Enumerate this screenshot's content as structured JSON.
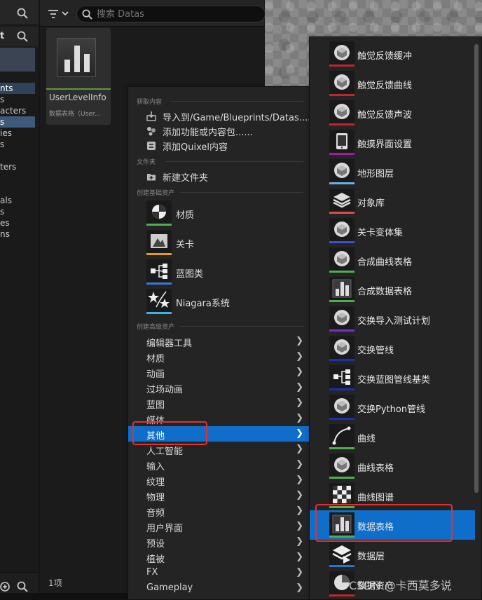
{
  "left_panel": {
    "tree_items": [
      "nts",
      "s",
      "acters",
      "s",
      "ies",
      "s",
      "ters",
      "als",
      "s",
      "es",
      "ns"
    ],
    "header_fragment": "t"
  },
  "asset_area": {
    "search_placeholder": "搜索 Datas",
    "asset": {
      "name": "UserLevelInfo",
      "type": "数据表格（User..."
    },
    "item_count": "1项"
  },
  "context_menu": {
    "sections": {
      "get_content": "获取内容",
      "folder": "文件夹",
      "basic_assets": "创建基础资产",
      "advanced_assets": "创建高级资产"
    },
    "get_content_items": [
      "导入到/Game/Blueprints/Datas.....",
      "添加功能或内容包......",
      "添加Quixel内容"
    ],
    "folder_items": [
      "新建文件夹"
    ],
    "basic_items": [
      {
        "label": "材质",
        "icon": "material-icon",
        "color": "#4caf50"
      },
      {
        "label": "关卡",
        "icon": "level-icon",
        "color": "#e89a1c"
      },
      {
        "label": "蓝图类",
        "icon": "blueprint-icon",
        "color": "#3a7bd5"
      },
      {
        "label": "Niagara系统",
        "icon": "niagara-icon",
        "color": "#2fb8e8"
      }
    ],
    "advanced_items": [
      "编辑器工具",
      "材质",
      "动画",
      "过场动画",
      "蓝图",
      "媒体",
      "其他",
      "人工智能",
      "输入",
      "纹理",
      "物理",
      "音频",
      "用户界面",
      "预设",
      "植被",
      "FX",
      "Gameplay"
    ],
    "selected": "其他"
  },
  "sub_menu": {
    "items": [
      {
        "label": "触觉反馈缓冲",
        "icon": "cube-icon",
        "color": "#c0262b"
      },
      {
        "label": "触觉反馈曲线",
        "icon": "cube-icon",
        "color": "#c0262b"
      },
      {
        "label": "触觉反馈声波",
        "icon": "cube-icon",
        "color": "#c0262b"
      },
      {
        "label": "触摸界面设置",
        "icon": "tablet-icon",
        "color": "#a31aa3"
      },
      {
        "label": "地形图层",
        "icon": "cube-icon",
        "color": "#6ab0e6"
      },
      {
        "label": "对象库",
        "icon": "stack-icon",
        "color": "#e14a4a"
      },
      {
        "label": "关卡变体集",
        "icon": "cube-icon",
        "color": "#3c4fd0"
      },
      {
        "label": "合成曲线表格",
        "icon": "cube-icon",
        "color": "#4caf50"
      },
      {
        "label": "合成数据表格",
        "icon": "datatable-icon",
        "color": "#4caf50"
      },
      {
        "label": "交换导入测试计划",
        "icon": "cube-icon",
        "color": "#7b2bd0"
      },
      {
        "label": "交换管线",
        "icon": "cube-icon",
        "color": "#1c2fb0"
      },
      {
        "label": "交换蓝图管线基类",
        "icon": "blueprint-icon",
        "color": "#1c2fb0"
      },
      {
        "label": "交换Python管线",
        "icon": "cube-icon",
        "color": "#1c2fb0"
      },
      {
        "label": "曲线",
        "icon": "curve-icon",
        "color": "#4caf50"
      },
      {
        "label": "曲线表格",
        "icon": "cube-icon",
        "color": "#4caf50"
      },
      {
        "label": "曲线图谱",
        "icon": "checker-icon",
        "color": "#4caf50"
      },
      {
        "label": "数据表格",
        "icon": "datatable-icon",
        "color": "#4caf50"
      },
      {
        "label": "数据层",
        "icon": "datalayer-icon",
        "color": "#1f78c8"
      },
      {
        "label": "数据资产",
        "icon": "pie-icon",
        "color": "#c0262b"
      }
    ],
    "selected": "数据表格"
  },
  "watermark": "CSDN @卡西莫多说"
}
